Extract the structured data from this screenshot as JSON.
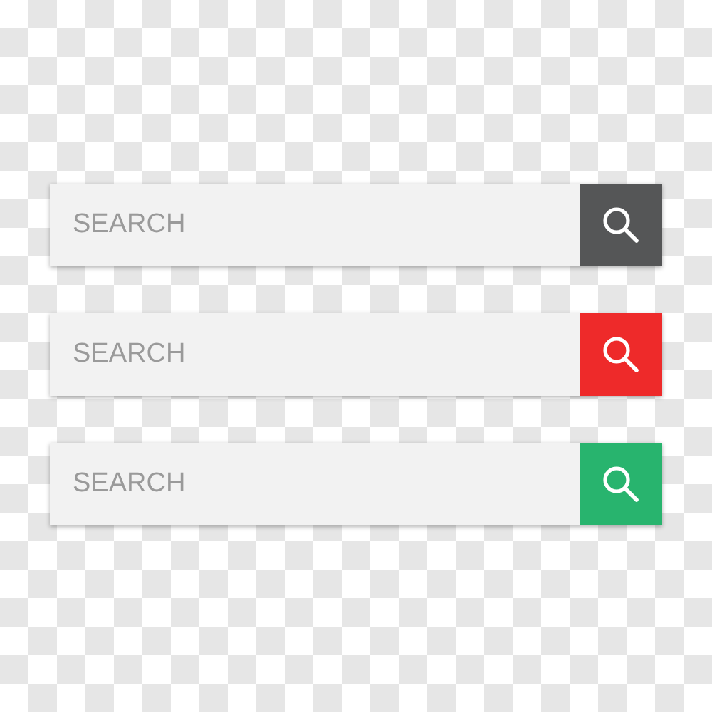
{
  "search_bars": [
    {
      "placeholder": "SEARCH",
      "color": "#555657"
    },
    {
      "placeholder": "SEARCH",
      "color": "#ee2a2a"
    },
    {
      "placeholder": "SEARCH",
      "color": "#28b46e"
    }
  ]
}
